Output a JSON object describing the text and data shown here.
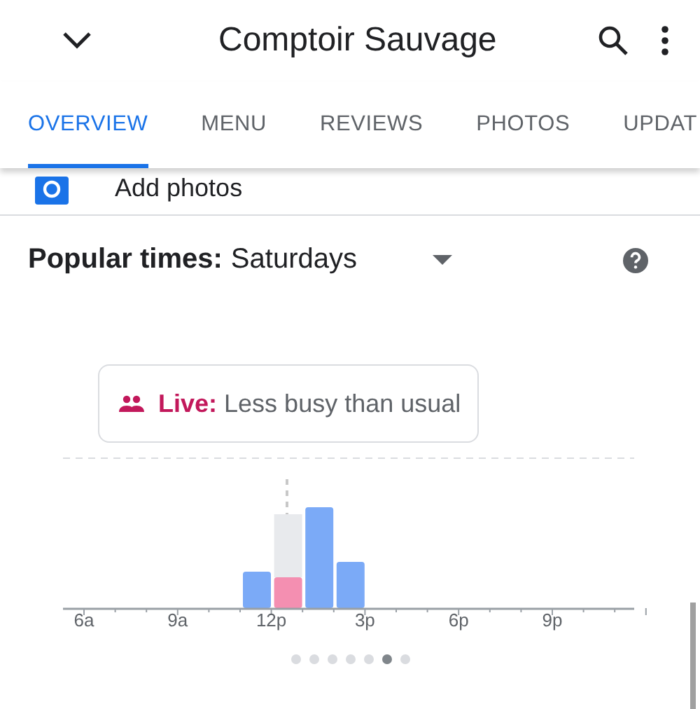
{
  "header": {
    "title": "Comptoir Sauvage"
  },
  "tabs": [
    {
      "label": "OVERVIEW",
      "selected": true
    },
    {
      "label": "MENU",
      "selected": false
    },
    {
      "label": "REVIEWS",
      "selected": false
    },
    {
      "label": "PHOTOS",
      "selected": false
    },
    {
      "label": "UPDAT",
      "selected": false
    }
  ],
  "add_photos": {
    "label": "Add photos"
  },
  "popular_times": {
    "title": "Popular times:",
    "day": "Saturdays",
    "live": {
      "label": "Live:",
      "text": "Less busy than usual"
    },
    "hour_labels": [
      "6a",
      "9a",
      "12p",
      "3p",
      "6p",
      "9p"
    ],
    "pages": [
      {
        "selected": false
      },
      {
        "selected": false
      },
      {
        "selected": false
      },
      {
        "selected": false
      },
      {
        "selected": false
      },
      {
        "selected": true
      },
      {
        "selected": false
      }
    ]
  }
}
